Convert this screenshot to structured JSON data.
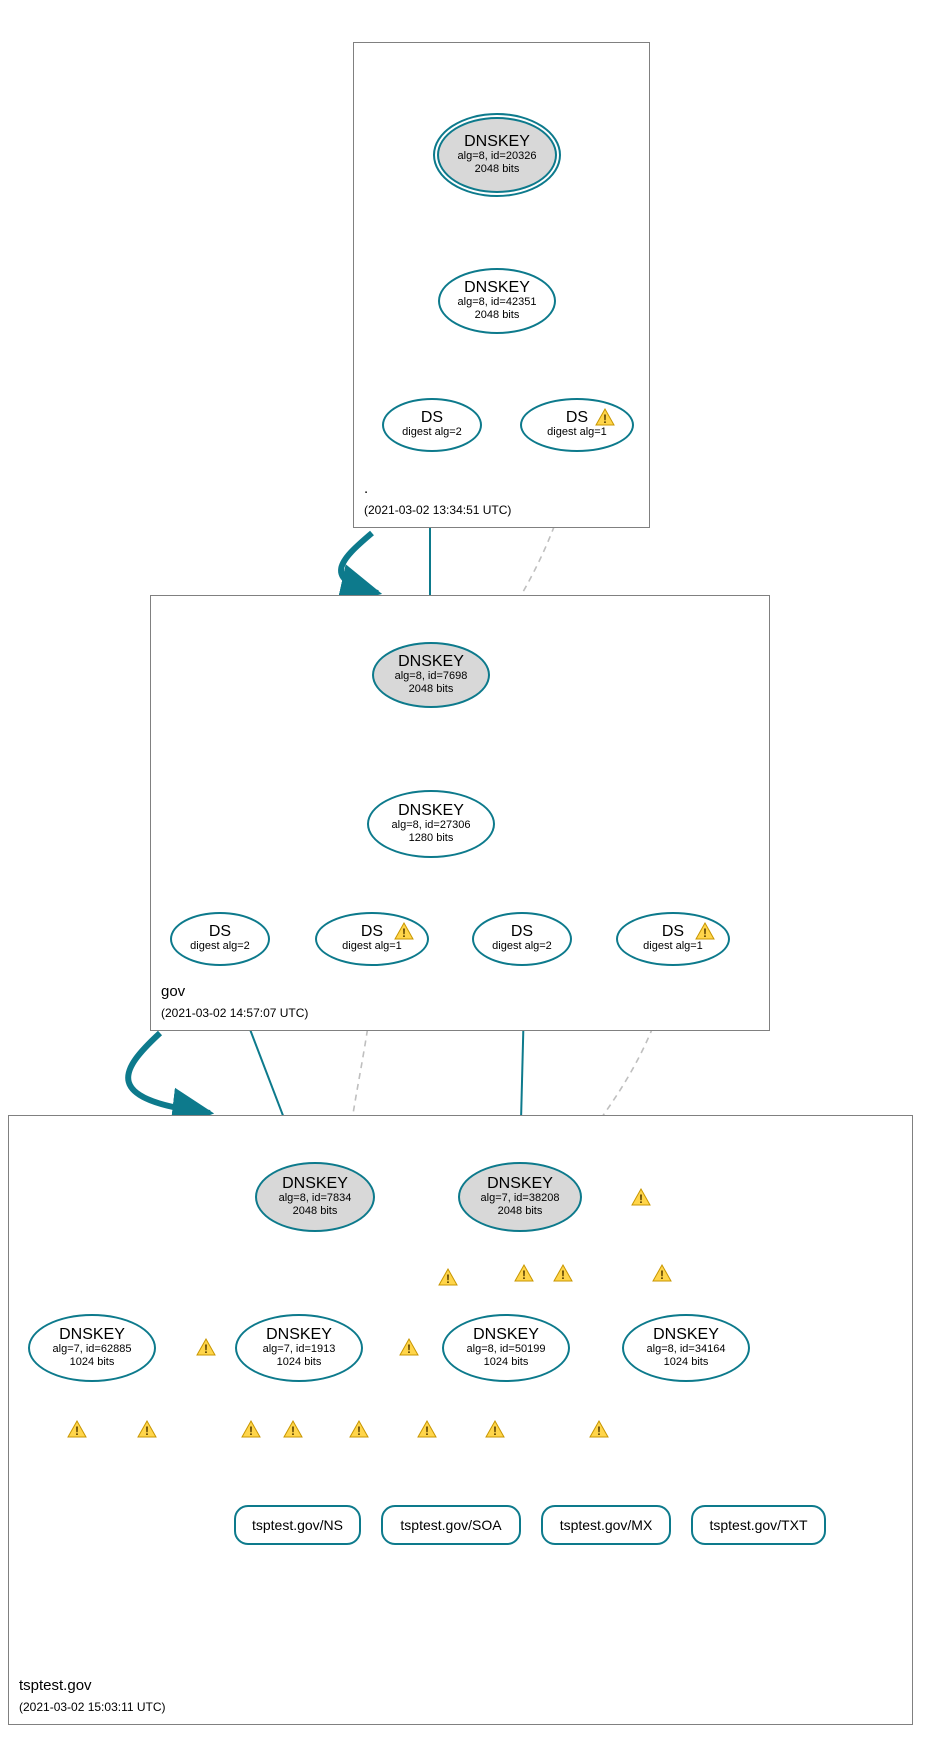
{
  "zones": {
    "root": {
      "name": ".",
      "time": "(2021-03-02 13:34:51 UTC)"
    },
    "gov": {
      "name": "gov",
      "time": "(2021-03-02 14:57:07 UTC)"
    },
    "tsptest": {
      "name": "tsptest.gov",
      "time": "(2021-03-02 15:03:11 UTC)"
    }
  },
  "nodes": {
    "root_ksk": {
      "title": "DNSKEY",
      "line1": "alg=8, id=20326",
      "line2": "2048 bits"
    },
    "root_zsk": {
      "title": "DNSKEY",
      "line1": "alg=8, id=42351",
      "line2": "2048 bits"
    },
    "root_ds2": {
      "title": "DS",
      "line1": "digest alg=2",
      "line2": ""
    },
    "root_ds1": {
      "title": "DS",
      "line1": "digest alg=1",
      "line2": ""
    },
    "gov_ksk": {
      "title": "DNSKEY",
      "line1": "alg=8, id=7698",
      "line2": "2048 bits"
    },
    "gov_zsk": {
      "title": "DNSKEY",
      "line1": "alg=8, id=27306",
      "line2": "1280 bits"
    },
    "gov_ds2a": {
      "title": "DS",
      "line1": "digest alg=2",
      "line2": ""
    },
    "gov_ds1a": {
      "title": "DS",
      "line1": "digest alg=1",
      "line2": ""
    },
    "gov_ds2b": {
      "title": "DS",
      "line1": "digest alg=2",
      "line2": ""
    },
    "gov_ds1b": {
      "title": "DS",
      "line1": "digest alg=1",
      "line2": ""
    },
    "tsp_ksk1": {
      "title": "DNSKEY",
      "line1": "alg=8, id=7834",
      "line2": "2048 bits"
    },
    "tsp_ksk2": {
      "title": "DNSKEY",
      "line1": "alg=7, id=38208",
      "line2": "2048 bits"
    },
    "tsp_zsk1": {
      "title": "DNSKEY",
      "line1": "alg=7, id=62885",
      "line2": "1024 bits"
    },
    "tsp_zsk2": {
      "title": "DNSKEY",
      "line1": "alg=7, id=1913",
      "line2": "1024 bits"
    },
    "tsp_zsk3": {
      "title": "DNSKEY",
      "line1": "alg=8, id=50199",
      "line2": "1024 bits"
    },
    "tsp_zsk4": {
      "title": "DNSKEY",
      "line1": "alg=8, id=34164",
      "line2": "1024 bits"
    }
  },
  "rr": {
    "ns": "tsptest.gov/NS",
    "soa": "tsptest.gov/SOA",
    "mx": "tsptest.gov/MX",
    "txt": "tsptest.gov/TXT"
  }
}
